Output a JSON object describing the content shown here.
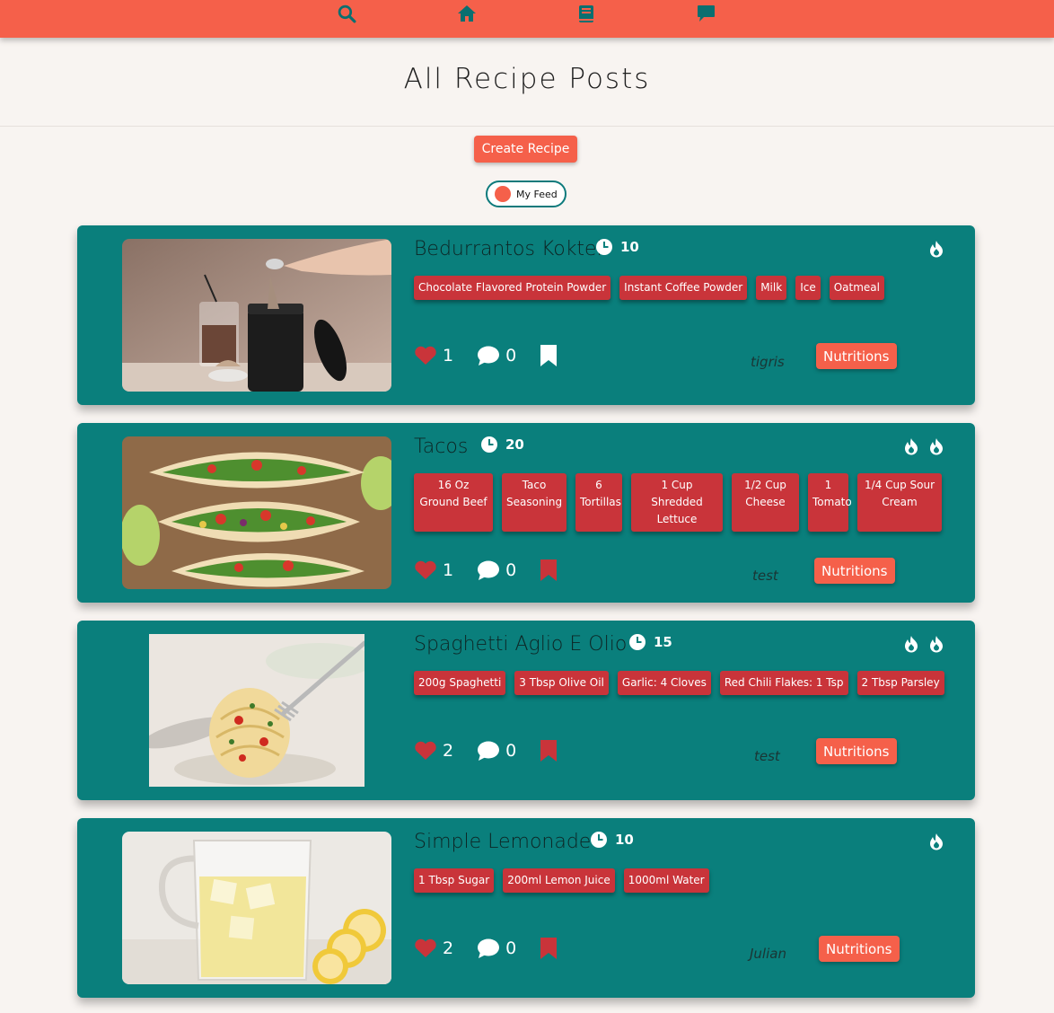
{
  "nav": {
    "icons": [
      "search-icon",
      "home-icon",
      "book-icon",
      "chat-icon"
    ]
  },
  "page": {
    "title": "All Recipe Posts",
    "create_label": "Create Recipe",
    "feed_label": "My Feed"
  },
  "colors": {
    "accent": "#f5604a",
    "card": "#0a7f7c",
    "tag": "#c9343a",
    "heart": "#c9343a",
    "bookmark_saved": "#ffffff",
    "bookmark_unsaved": "#c9343a"
  },
  "posts": [
    {
      "title": "Bedurrantos Koktel",
      "time": "10",
      "flames": 1,
      "ingredients": [
        "Chocolate Flavored Protein Powder",
        "Instant Coffee Powder",
        "Milk",
        "Ice",
        "Oatmeal"
      ],
      "likes": "1",
      "comments": "0",
      "bookmarked": true,
      "author": "tigris",
      "nutrition_label": "Nutritions",
      "image": "protein-shake-photo"
    },
    {
      "title": "Tacos",
      "time": "20",
      "flames": 2,
      "ingredients": [
        "16 Oz Ground Beef",
        "Taco Seasoning",
        "6 Tortillas",
        "1 Cup Shredded Lettuce",
        "1/2 Cup Cheese",
        "1 Tomato",
        "1/4 Cup Sour Cream"
      ],
      "likes": "1",
      "comments": "0",
      "bookmarked": false,
      "author": "test",
      "nutrition_label": "Nutritions",
      "image": "tacos-photo"
    },
    {
      "title": "Spaghetti Aglio E Olio",
      "time": "15",
      "flames": 2,
      "ingredients": [
        "200g Spaghetti",
        "3 Tbsp Olive Oil",
        "Garlic: 4 Cloves",
        "Red Chili Flakes: 1 Tsp",
        "2 Tbsp Parsley"
      ],
      "likes": "2",
      "comments": "0",
      "bookmarked": false,
      "author": "test",
      "nutrition_label": "Nutritions",
      "image": "spaghetti-photo"
    },
    {
      "title": "Simple Lemonade",
      "time": "10",
      "flames": 1,
      "ingredients": [
        "1 Tbsp Sugar",
        "200ml Lemon Juice",
        "1000ml Water"
      ],
      "likes": "2",
      "comments": "0",
      "bookmarked": false,
      "author": "Julian",
      "nutrition_label": "Nutritions",
      "image": "lemonade-photo"
    }
  ]
}
